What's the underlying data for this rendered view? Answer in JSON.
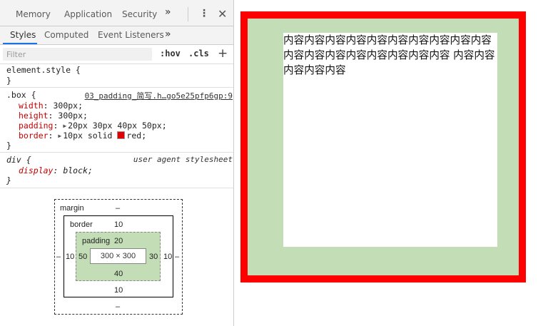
{
  "devtools": {
    "tabs": {
      "memory": "Memory",
      "application": "Application",
      "security": "Security",
      "more": "»"
    },
    "subtabs": {
      "styles": "Styles",
      "computed": "Computed",
      "event_listeners": "Event Listeners",
      "more": "»"
    },
    "filter": {
      "placeholder": "Filter",
      "hov": ":hov",
      "cls": ".cls",
      "add": "+"
    },
    "rules": {
      "element_style": {
        "selector": "element.style {",
        "close": "}"
      },
      "box": {
        "selector": ".box {",
        "source": "03_padding_简写.h…go5e25pfp6gp:9",
        "props": [
          {
            "name": "width",
            "value": "300px;"
          },
          {
            "name": "height",
            "value": "300px;"
          },
          {
            "name": "padding",
            "value": "20px 30px 40px 50px;"
          },
          {
            "name": "border",
            "value": "10px solid",
            "color_name": "red;",
            "color": "#ff0000"
          }
        ],
        "close": "}"
      },
      "div": {
        "selector": "div {",
        "source": "user agent stylesheet",
        "props": [
          {
            "name": "display",
            "value": "block;"
          }
        ],
        "close": "}"
      }
    },
    "box_model": {
      "margin_label": "margin",
      "margin_top": "–",
      "margin_bottom": "–",
      "margin_left": "–",
      "margin_right": "–",
      "border_label": "border",
      "border_top": "10",
      "border_bottom": "10",
      "border_left": "10",
      "border_right": "10",
      "padding_label": "padding",
      "padding_top": "20",
      "padding_bottom": "40",
      "padding_left": "50",
      "padding_right": "30",
      "content": "300 × 300"
    }
  },
  "page": {
    "box_text": "内容内容内容内容内容内容内容内容内容内容内容内容内容内容内容内容内容内容 内容内容内容内容内容",
    "colors": {
      "border": "#ff0000",
      "padding": "#c3deb6",
      "content": "#ffffff"
    }
  }
}
